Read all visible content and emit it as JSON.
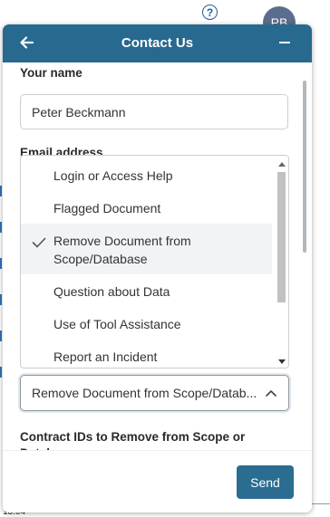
{
  "background": {
    "help_icon": "?",
    "avatar_initials": "PB",
    "time_fragment": "13:04"
  },
  "panel": {
    "title": "Contact Us",
    "header_color": "#27698f",
    "back_icon": "arrow-left-icon",
    "minimize_icon": "minimize-icon"
  },
  "form": {
    "name_label": "Your name",
    "name_value": "Peter Beckmann",
    "email_label": "Email address",
    "type_select_value": "Remove Document from Scope/Datab...",
    "type_options": [
      {
        "label": "Login or Access Help",
        "selected": false
      },
      {
        "label": "Flagged Document",
        "selected": false
      },
      {
        "label": "Remove Document from Scope/Database",
        "selected": true
      },
      {
        "label": "Question about Data",
        "selected": false
      },
      {
        "label": "Use of Tool Assistance",
        "selected": false
      },
      {
        "label": "Report an Incident",
        "selected": false
      }
    ],
    "contract_ids_label": "Contract IDs to Remove from Scope or Database"
  },
  "footer": {
    "send_label": "Send",
    "send_color": "#2a6d91"
  }
}
